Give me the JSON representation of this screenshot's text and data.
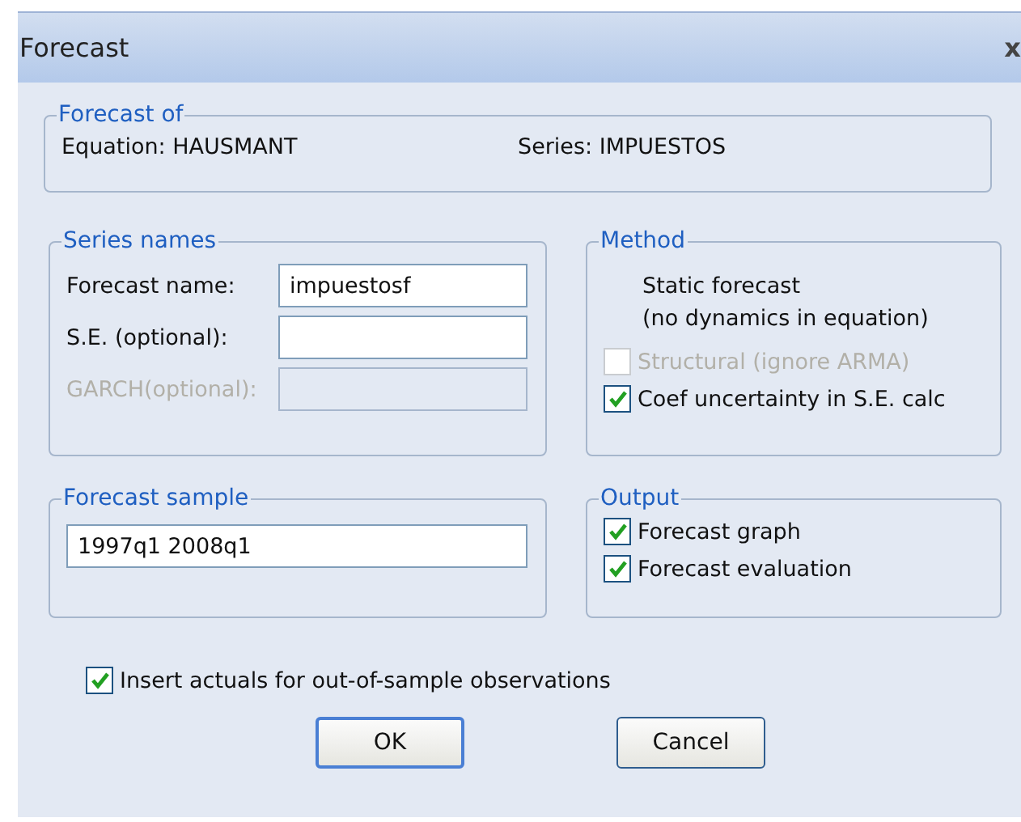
{
  "window": {
    "title": "Forecast",
    "close": "x"
  },
  "forecast_of": {
    "label": "Forecast of",
    "equation": "Equation: HAUSMANT",
    "series": "Series: IMPUESTOS"
  },
  "series_names": {
    "label": "Series names",
    "fields": [
      {
        "label": "Forecast name:",
        "value": "impuestosf",
        "disabled": false
      },
      {
        "label": "S.E. (optional):",
        "disabled": false
      },
      {
        "label": "GARCH(optional):",
        "disabled": true
      }
    ]
  },
  "method": {
    "label": "Method",
    "description": [
      "Static forecast",
      "(no dynamics in equation)"
    ],
    "options": [
      {
        "label": "Structural (ignore ARMA)",
        "checked": false,
        "disabled": true
      },
      {
        "label": "Coef uncertainty in S.E. calc",
        "checked": true,
        "disabled": false
      }
    ]
  },
  "forecast_sample": {
    "label": "Forecast sample",
    "value": "1997q1 2008q1"
  },
  "output": {
    "label": "Output",
    "options": [
      {
        "label": "Forecast graph",
        "checked": true,
        "disabled": false
      },
      {
        "label": "Forecast evaluation",
        "checked": true,
        "disabled": false
      }
    ]
  },
  "insert_actuals": {
    "label": "Insert actuals for out-of-sample observations",
    "checked": true,
    "disabled": false
  },
  "buttons": [
    {
      "label": "OK",
      "default": true
    },
    {
      "label": "Cancel",
      "default": false
    }
  ]
}
